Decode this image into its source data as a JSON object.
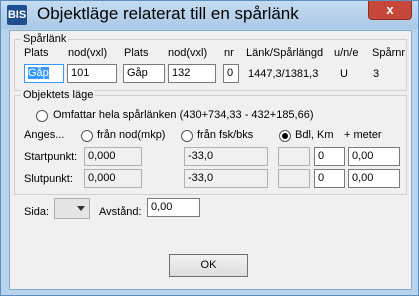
{
  "window": {
    "title": "Objektläge relaterat till en spårlänk",
    "icon_label": "BIS",
    "close_label": "x"
  },
  "sparlank": {
    "group_label": "Spårlänk",
    "headers": {
      "plats1": "Plats",
      "nod1": "nod(vxl)",
      "plats2": "Plats",
      "nod2": "nod(vxl)",
      "nr": "nr",
      "langd": "Länk/Spårlängd",
      "une": "u/n/e",
      "sparnr": "Spårnr"
    },
    "values": {
      "plats1": "Gåp",
      "nod1": "101",
      "plats2": "Gåp",
      "nod2": "132",
      "nr": "0",
      "langd": "1447,3/1381,3",
      "une": "U",
      "sparnr": "3"
    }
  },
  "objektets_lage": {
    "group_label": "Objektets läge",
    "omfattar_label": "Omfattar hela spårlänken (430+734,33 - 432+185,66)",
    "anges_label": "Anges...",
    "option_nod": "från nod(mkp)",
    "option_fsk": "från fsk/bks",
    "option_bdl": "Bdl,",
    "km_label": "Km",
    "meter_label": "+ meter",
    "startpunkt_label": "Startpunkt:",
    "slutpunkt_label": "Slutpunkt:",
    "start": {
      "nod": "0,000",
      "fsk": "-33,0",
      "bdl": "",
      "km": "0",
      "meter": "0,00"
    },
    "slut": {
      "nod": "0,000",
      "fsk": "-33,0",
      "bdl": "",
      "km": "0",
      "meter": "0,00"
    }
  },
  "bottom": {
    "sida_label": "Sida:",
    "sida_value": "",
    "avstand_label": "Avstånd:",
    "avstand_value": "0,00"
  },
  "ok_label": "OK"
}
